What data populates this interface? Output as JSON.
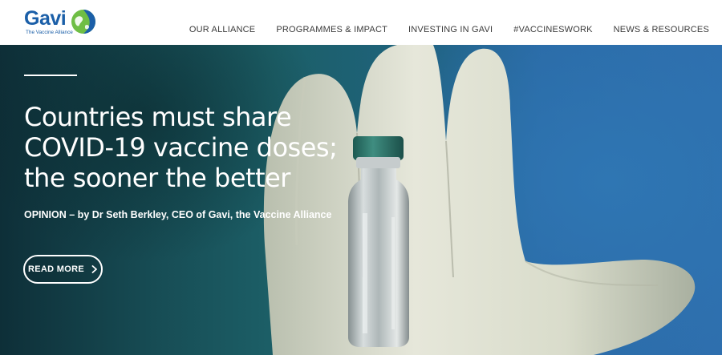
{
  "header": {
    "logo": {
      "name": "Gavi",
      "tagline": "The Vaccine Alliance"
    },
    "nav": [
      {
        "label": "OUR ALLIANCE"
      },
      {
        "label": "PROGRAMMES & IMPACT"
      },
      {
        "label": "INVESTING IN GAVI"
      },
      {
        "label": "#VACCINESWORK"
      },
      {
        "label": "NEWS & RESOURCES"
      }
    ]
  },
  "hero": {
    "headline_lines": [
      "Countries must share",
      "COVID-19 vaccine doses;",
      "the sooner the better"
    ],
    "byline": "OPINION – by Dr Seth Berkley, CEO of Gavi, the Vaccine Alliance",
    "cta_label": "READ MORE",
    "image": "gloved hand holding a vaccine vial"
  },
  "colors": {
    "brand_blue": "#1b5fa8",
    "brand_green": "#6fbe44",
    "nav_text": "#3a3a3a",
    "hero_text": "#ffffff"
  },
  "icons": [
    "gavi-globe-logo",
    "chevron-right-icon"
  ]
}
